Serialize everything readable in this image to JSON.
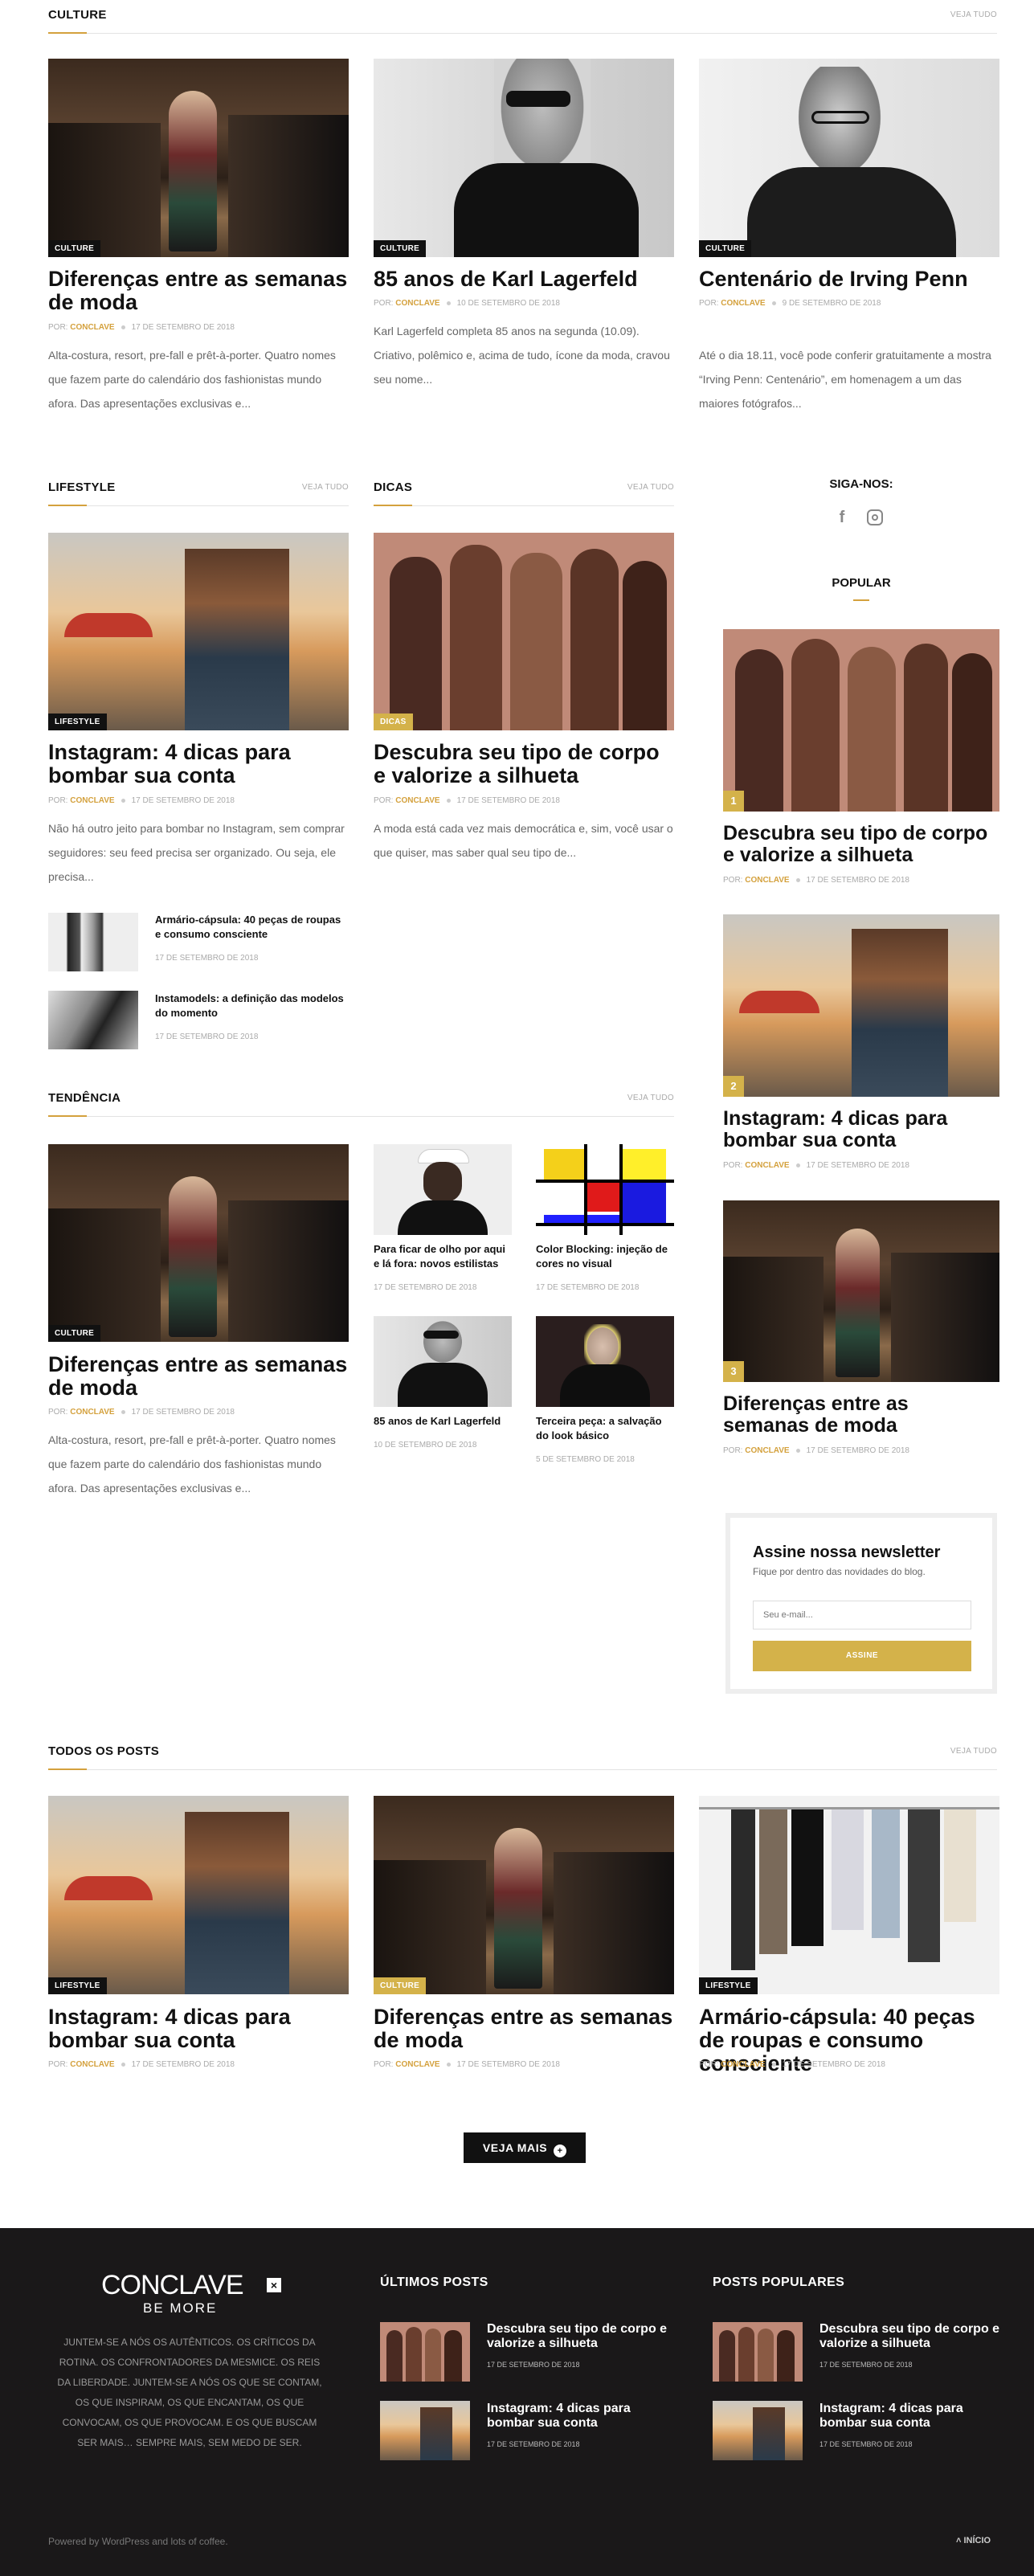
{
  "culture": {
    "title": "CULTURE",
    "view_all": "VEJA TUDO",
    "posts": [
      {
        "tag": "CULTURE",
        "title": "Diferenças entre as semanas de moda",
        "by": "POR:",
        "author": "CONCLAVE",
        "date": "17 DE SETEMBRO DE 2018",
        "excerpt": "Alta-costura, resort, pre-fall e prêt-à-porter. Quatro nomes que fazem parte do calendário dos fashionistas mundo afora. Das apresentações exclusivas e..."
      },
      {
        "tag": "CULTURE",
        "title": "85 anos de Karl Lagerfeld",
        "by": "POR:",
        "author": "CONCLAVE",
        "date": "10 DE SETEMBRO DE 2018",
        "excerpt": "Karl Lagerfeld completa 85 anos na segunda (10.09). Criativo, polêmico e, acima de tudo, ícone da moda, cravou seu nome..."
      },
      {
        "tag": "CULTURE",
        "title": "Centenário de Irving Penn",
        "by": "POR:",
        "author": "CONCLAVE",
        "date": "9 DE SETEMBRO DE 2018",
        "excerpt": "Até o dia 18.11, você pode conferir gratuitamente a mostra “Irving Penn: Centenário”, em homenagem a um das maiores fotógrafos..."
      }
    ]
  },
  "lifestyle": {
    "title": "LIFESTYLE",
    "view_all": "VEJA TUDO",
    "main": {
      "tag": "LIFESTYLE",
      "title": "Instagram: 4 dicas para bombar sua conta",
      "by": "POR:",
      "author": "CONCLAVE",
      "date": "17 DE SETEMBRO DE 2018",
      "excerpt": "Não há outro jeito para bombar no Instagram, sem comprar seguidores: seu feed precisa ser organizado. Ou seja, ele precisa..."
    },
    "small": [
      {
        "title": "Armário-cápsula: 40 peças de roupas e consumo consciente",
        "date": "17 DE SETEMBRO DE 2018"
      },
      {
        "title": "Instamodels: a definição das modelos do momento",
        "date": "17 DE SETEMBRO DE 2018"
      }
    ]
  },
  "dicas": {
    "title": "DICAS",
    "view_all": "VEJA TUDO",
    "main": {
      "tag": "DICAS",
      "title": "Descubra seu tipo de corpo e valorize a silhueta",
      "by": "POR:",
      "author": "CONCLAVE",
      "date": "17 DE SETEMBRO DE 2018",
      "excerpt": "A moda está cada vez mais democrática e, sim, você usar o que quiser, mas saber qual seu tipo de..."
    }
  },
  "sidebar": {
    "follow": "SIGA-NOS:",
    "popular": "POPULAR",
    "posts": [
      {
        "num": "1",
        "title": "Descubra seu tipo de corpo e valorize a silhueta",
        "by": "POR:",
        "author": "CONCLAVE",
        "date": "17 DE SETEMBRO DE 2018"
      },
      {
        "num": "2",
        "title": "Instagram: 4 dicas para bombar sua conta",
        "by": "POR:",
        "author": "CONCLAVE",
        "date": "17 DE SETEMBRO DE 2018"
      },
      {
        "num": "3",
        "title": "Diferenças entre as semanas de moda",
        "by": "POR:",
        "author": "CONCLAVE",
        "date": "17 DE SETEMBRO DE 2018"
      }
    ],
    "newsletter": {
      "title": "Assine nossa newsletter",
      "subtitle": "Fique por dentro das novidades do blog.",
      "placeholder": "Seu e-mail...",
      "button": "ASSINE"
    }
  },
  "tendencia": {
    "title": "TENDÊNCIA",
    "view_all": "VEJA TUDO",
    "main": {
      "tag": "CULTURE",
      "title": "Diferenças entre as semanas de moda",
      "by": "POR:",
      "author": "CONCLAVE",
      "date": "17 DE SETEMBRO DE 2018",
      "excerpt": "Alta-costura, resort, pre-fall e prêt-à-porter. Quatro nomes que fazem parte do calendário dos fashionistas mundo afora. Das apresentações exclusivas e..."
    },
    "small": [
      {
        "title": "Para ficar de olho por aqui e lá fora: novos estilistas",
        "date": "17 DE SETEMBRO DE 2018"
      },
      {
        "title": "Color Blocking: injeção de cores no visual",
        "date": "17 DE SETEMBRO DE 2018"
      },
      {
        "title": "85 anos de Karl Lagerfeld",
        "date": "10 DE SETEMBRO DE 2018"
      },
      {
        "title": "Terceira peça: a salvação do look básico",
        "date": "5 DE SETEMBRO DE 2018"
      }
    ]
  },
  "all_posts": {
    "title": "TODOS OS POSTS",
    "view_all": "VEJA TUDO",
    "posts": [
      {
        "tag": "LIFESTYLE",
        "title": "Instagram: 4 dicas para bombar sua conta",
        "by": "POR:",
        "author": "CONCLAVE",
        "date": "17 DE SETEMBRO DE 2018"
      },
      {
        "tag": "CULTURE",
        "title": "Diferenças entre as semanas de moda",
        "by": "POR:",
        "author": "CONCLAVE",
        "date": "17 DE SETEMBRO DE 2018"
      },
      {
        "tag": "LIFESTYLE",
        "title": "Armário-cápsula: 40 peças de roupas e consumo consciente",
        "by": "POR:",
        "author": "CONCLAVE",
        "date": "17 DE SETEMBRO DE 2018"
      }
    ],
    "more_button": "VEJA MAIS"
  },
  "footer": {
    "logo": "CONCLAVE",
    "logo_sub": "BE MORE",
    "about": "JUNTEM-SE A NÓS OS AUTÊNTICOS. OS CRÍTICOS DA ROTINA. OS CONFRONTADORES DA MESMICE. OS REIS DA LIBERDADE. JUNTEM-SE A NÓS OS QUE SE CONTAM, OS QUE INSPIRAM, OS QUE ENCANTAM, OS QUE CONVOCAM, OS QUE PROVOCAM. E OS QUE BUSCAM SER MAIS… SEMPRE MAIS, SEM MEDO DE SER.",
    "latest_title": "ÚLTIMOS POSTS",
    "popular_title": "POSTS POPULARES",
    "latest": [
      {
        "title": "Descubra seu tipo de corpo e valorize a silhueta",
        "date": "17 DE SETEMBRO DE 2018"
      },
      {
        "title": "Instagram: 4 dicas para bombar sua conta",
        "date": "17 DE SETEMBRO DE 2018"
      }
    ],
    "popular": [
      {
        "title": "Descubra seu tipo de corpo e valorize a silhueta",
        "date": "17 DE SETEMBRO DE 2018"
      },
      {
        "title": "Instagram: 4 dicas para bombar sua conta",
        "date": "17 DE SETEMBRO DE 2018"
      }
    ],
    "credits": "Powered by WordPress and lots of coffee.",
    "top_link": "INÍCIO"
  }
}
